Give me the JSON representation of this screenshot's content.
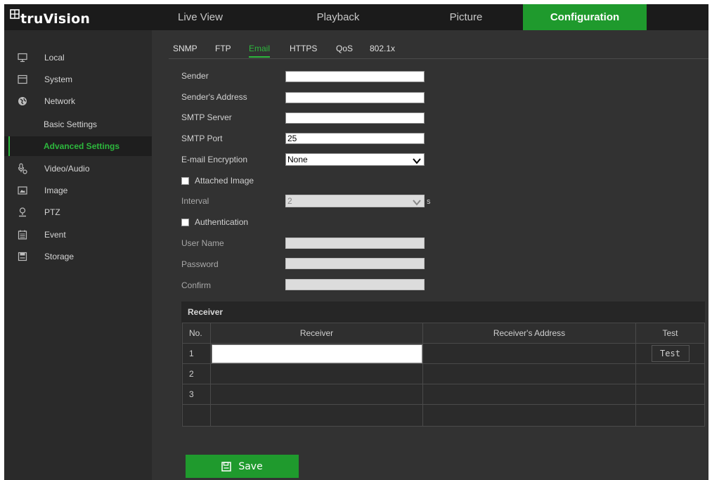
{
  "app": {
    "logo": "truVision"
  },
  "nav": {
    "tabs": [
      {
        "label": "Live View"
      },
      {
        "label": "Playback"
      },
      {
        "label": "Picture"
      },
      {
        "label": "Configuration"
      }
    ]
  },
  "sidebar": {
    "items": [
      {
        "label": "Local",
        "icon": "monitor-icon"
      },
      {
        "label": "System",
        "icon": "system-icon"
      },
      {
        "label": "Network",
        "icon": "globe-icon"
      },
      {
        "label": "Basic Settings"
      },
      {
        "label": "Advanced Settings"
      },
      {
        "label": "Video/Audio",
        "icon": "microphone-icon"
      },
      {
        "label": "Image",
        "icon": "image-icon"
      },
      {
        "label": "PTZ",
        "icon": "ptz-camera-icon"
      },
      {
        "label": "Event",
        "icon": "calendar-icon"
      },
      {
        "label": "Storage",
        "icon": "storage-icon"
      }
    ]
  },
  "subtabs": [
    {
      "label": "SNMP"
    },
    {
      "label": "FTP"
    },
    {
      "label": "Email"
    },
    {
      "label": "HTTPS"
    },
    {
      "label": "QoS"
    },
    {
      "label": "802.1x"
    }
  ],
  "form": {
    "sender": {
      "label": "Sender",
      "value": ""
    },
    "sender_address": {
      "label": "Sender's Address",
      "value": ""
    },
    "smtp_server": {
      "label": "SMTP Server",
      "value": ""
    },
    "smtp_port": {
      "label": "SMTP Port",
      "value": "25"
    },
    "encryption": {
      "label": "E-mail Encryption",
      "value": "None"
    },
    "attached_image": {
      "label": "Attached Image",
      "checked": false
    },
    "interval": {
      "label": "Interval",
      "value": "2",
      "unit": "s"
    },
    "authentication": {
      "label": "Authentication",
      "checked": false
    },
    "user_name": {
      "label": "User Name",
      "value": ""
    },
    "password": {
      "label": "Password",
      "value": ""
    },
    "confirm": {
      "label": "Confirm",
      "value": ""
    }
  },
  "receiver": {
    "title": "Receiver",
    "columns": {
      "no": "No.",
      "receiver": "Receiver",
      "address": "Receiver's Address",
      "test": "Test"
    },
    "rows": [
      {
        "no": "1",
        "receiver": "",
        "address": "",
        "test_label": "Test"
      },
      {
        "no": "2",
        "receiver": "",
        "address": ""
      },
      {
        "no": "3",
        "receiver": "",
        "address": ""
      }
    ]
  },
  "save_label": "Save",
  "colors": {
    "accent": "#1f9a2d",
    "accent_text": "#2db83d",
    "background": "#323232",
    "sidebar": "#2a2a2a",
    "topbar": "#1b1b1b"
  }
}
